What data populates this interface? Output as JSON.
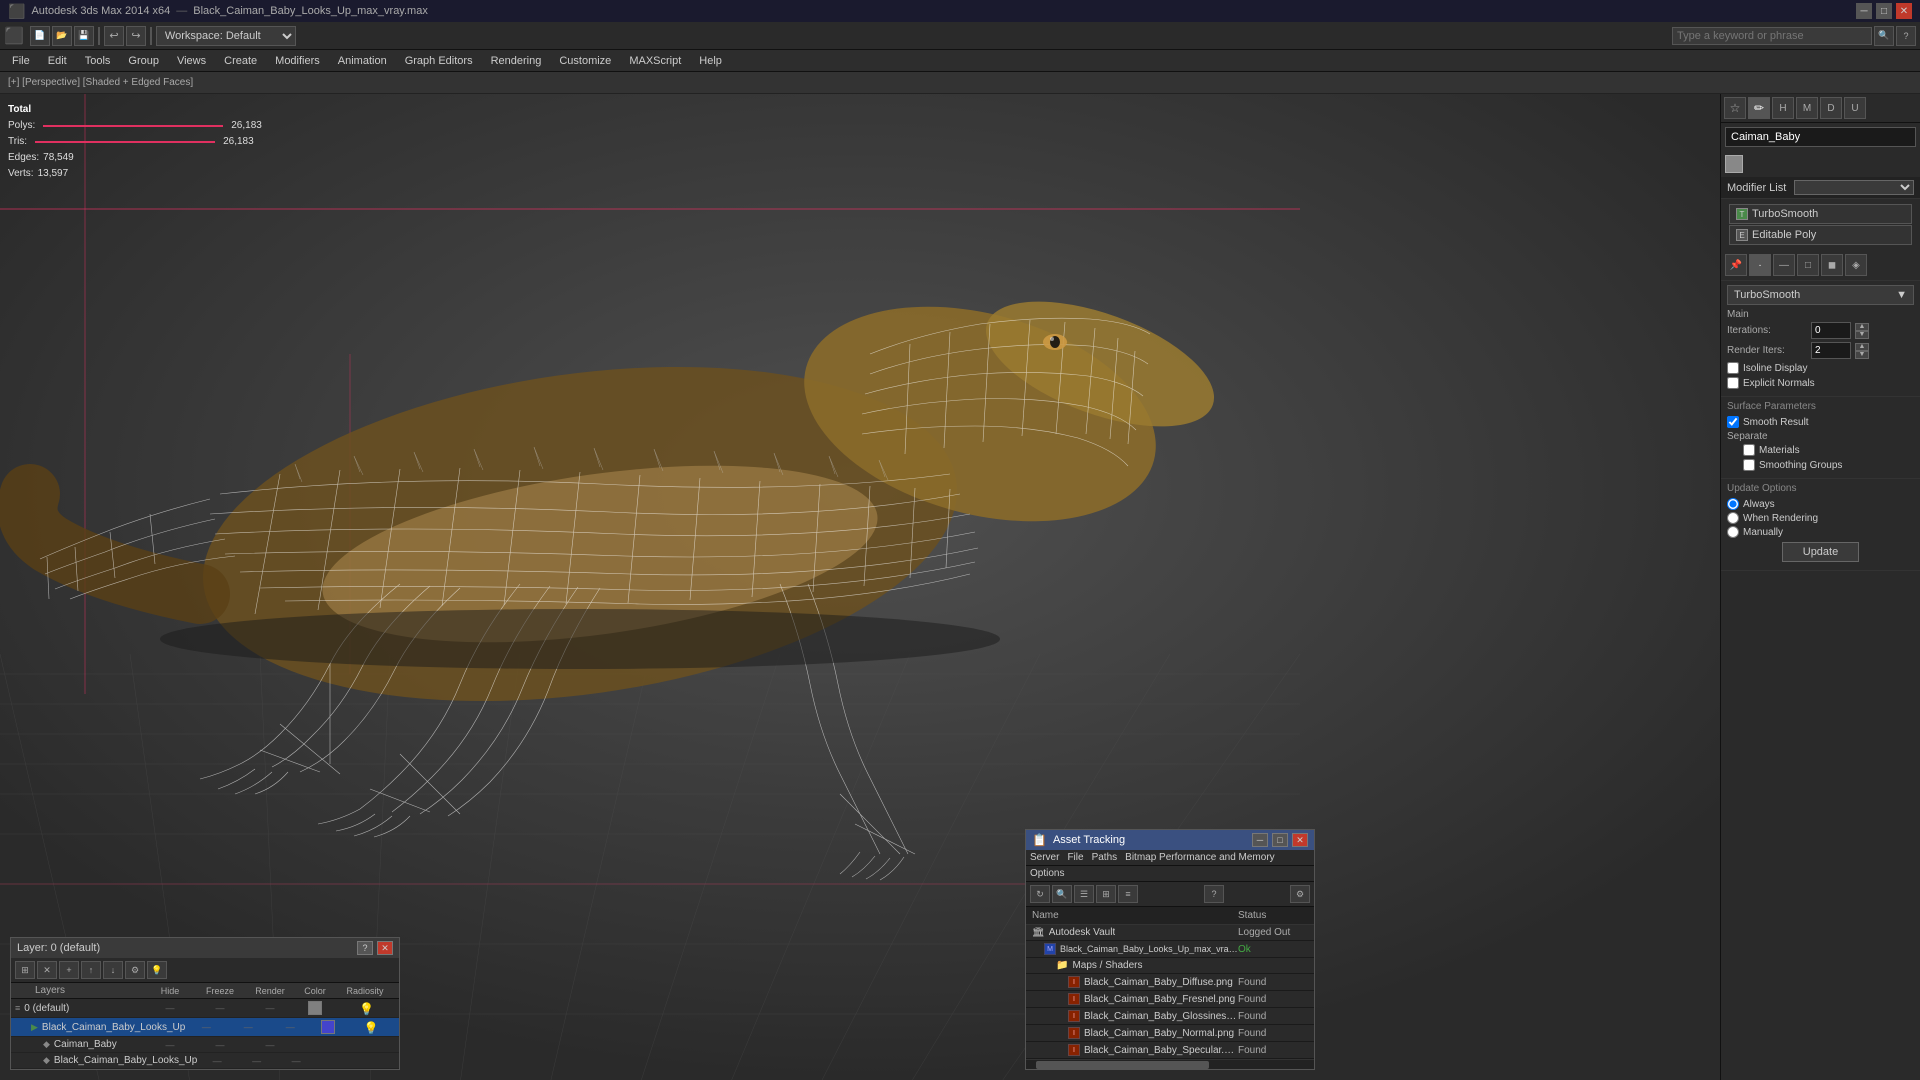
{
  "app": {
    "title": "Autodesk 3ds Max 2014 x64",
    "file": "Black_Caiman_Baby_Looks_Up_max_vray.max",
    "search_placeholder": "Type a keyword or phrase"
  },
  "workspace": {
    "label": "Workspace: Default"
  },
  "title_bar": {
    "minimize": "─",
    "restore": "□",
    "close": "✕"
  },
  "menus": {
    "items": [
      {
        "label": "File"
      },
      {
        "label": "Edit"
      },
      {
        "label": "Tools"
      },
      {
        "label": "Group"
      },
      {
        "label": "Views"
      },
      {
        "label": "Create"
      },
      {
        "label": "Modifiers"
      },
      {
        "label": "Animation"
      },
      {
        "label": "Graph Editors"
      },
      {
        "label": "Rendering"
      },
      {
        "label": "Customize"
      },
      {
        "label": "MAXScript"
      },
      {
        "label": "Help"
      }
    ]
  },
  "viewport": {
    "label": "[+] [Perspective] [Shaded + Edged Faces]"
  },
  "stats": {
    "title": "Total",
    "polys_label": "Polys:",
    "polys_value": "26,183",
    "tris_label": "Tris:",
    "tris_value": "26,183",
    "edges_label": "Edges:",
    "edges_value": "78,549",
    "verts_label": "Verts:",
    "verts_value": "13,597"
  },
  "right_panel": {
    "object_name": "Caiman_Baby",
    "modifier_list_label": "Modifier List",
    "modifiers": [
      {
        "name": "TurboSmooth",
        "type": "turbo"
      },
      {
        "name": "Editable Poly",
        "type": "edit"
      }
    ],
    "turbosmooth": {
      "title": "TurboSmooth",
      "main_label": "Main",
      "iterations_label": "Iterations:",
      "iterations_value": "0",
      "render_iters_label": "Render Iters:",
      "render_iters_value": "2",
      "isoline_display": "Isoline Display",
      "explicit_normals": "Explicit Normals",
      "surface_params_label": "Surface Parameters",
      "smooth_result": "Smooth Result",
      "smooth_result_checked": true,
      "separate_label": "Separate",
      "materials": "Materials",
      "smoothing_groups": "Smoothing Groups",
      "update_options_label": "Update Options",
      "always": "Always",
      "when_rendering": "When Rendering",
      "manually": "Manually",
      "update_btn": "Update"
    }
  },
  "layers_panel": {
    "title": "Layer: 0 (default)",
    "close_btn": "✕",
    "help_btn": "?",
    "columns": {
      "name": "Layers",
      "hide": "Hide",
      "freeze": "Freeze",
      "render": "Render",
      "color": "Color",
      "radiosity": "Radiosity"
    },
    "rows": [
      {
        "indent": 0,
        "name": "0 (default)",
        "type": "layer",
        "active": false,
        "hide": "",
        "freeze": "",
        "render": "",
        "color": "#808080"
      },
      {
        "indent": 1,
        "name": "Black_Caiman_Baby_Looks_Up",
        "type": "object",
        "active": true,
        "hide": "",
        "freeze": "",
        "render": "",
        "color": "#4444cc"
      },
      {
        "indent": 2,
        "name": "Caiman_Baby",
        "type": "object",
        "active": false
      },
      {
        "indent": 2,
        "name": "Black_Caiman_Baby_Looks_Up",
        "type": "object",
        "active": false
      }
    ]
  },
  "asset_panel": {
    "title": "Asset Tracking",
    "menus": [
      "Server",
      "File",
      "Paths",
      "Bitmap Performance and Memory",
      "Options"
    ],
    "columns": {
      "name": "Name",
      "status": "Status"
    },
    "rows": [
      {
        "indent": 0,
        "name": "Autodesk Vault",
        "type": "vault",
        "status": "Logged Out"
      },
      {
        "indent": 1,
        "name": "Black_Caiman_Baby_Looks_Up_max_vray.max",
        "type": "max",
        "status": "Ok"
      },
      {
        "indent": 2,
        "name": "Maps / Shaders",
        "type": "folder"
      },
      {
        "indent": 3,
        "name": "Black_Caiman_Baby_Diffuse.png",
        "type": "img",
        "status": "Found"
      },
      {
        "indent": 3,
        "name": "Black_Caiman_Baby_Fresnel.png",
        "type": "img",
        "status": "Found"
      },
      {
        "indent": 3,
        "name": "Black_Caiman_Baby_Glossiness.png",
        "type": "img",
        "status": "Found"
      },
      {
        "indent": 3,
        "name": "Black_Caiman_Baby_Normal.png",
        "type": "img",
        "status": "Found"
      },
      {
        "indent": 3,
        "name": "Black_Caiman_Baby_Specular.png",
        "type": "img",
        "status": "Found"
      }
    ]
  }
}
